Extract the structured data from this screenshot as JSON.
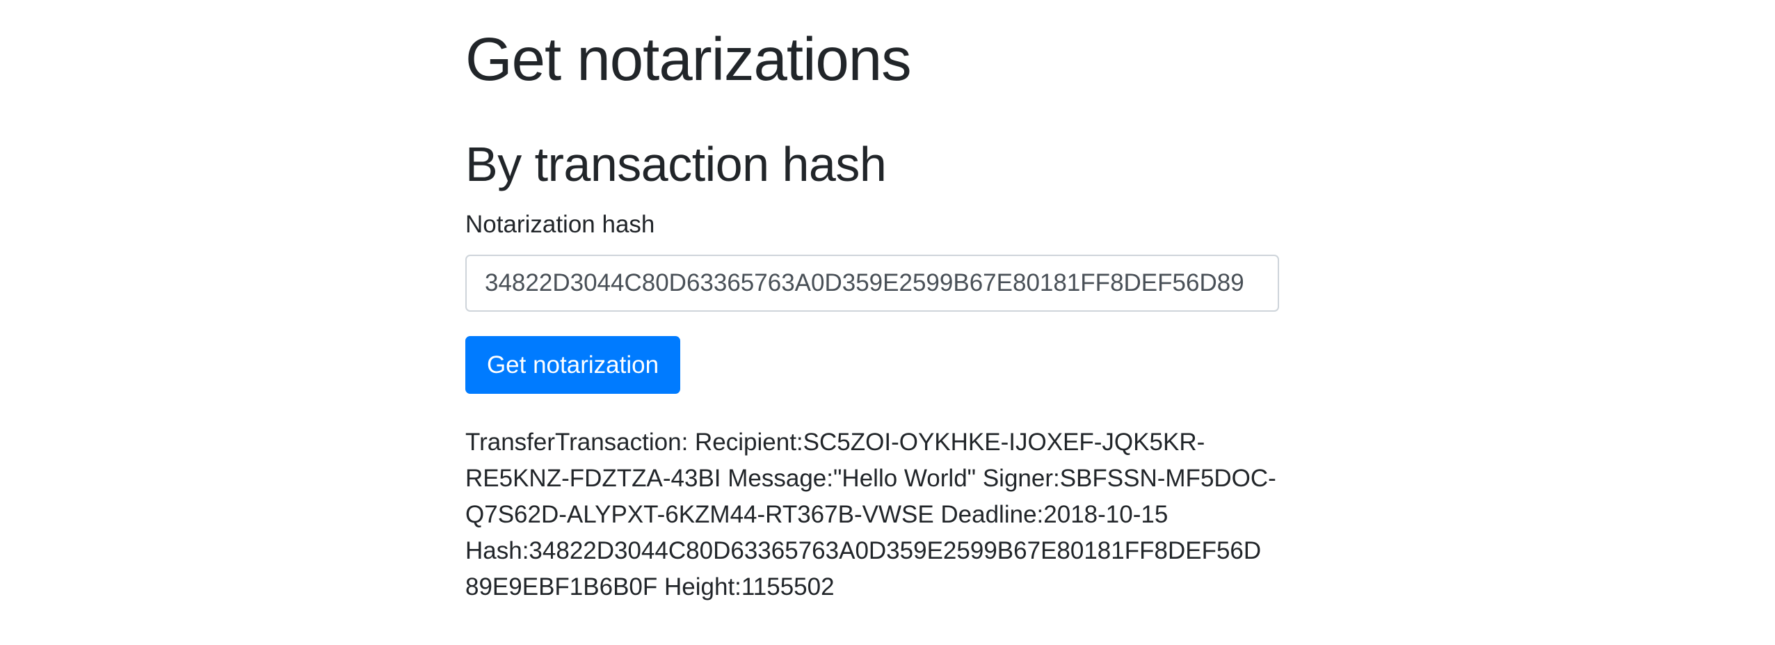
{
  "page": {
    "title": "Get notarizations"
  },
  "section": {
    "title": "By transaction hash"
  },
  "form": {
    "label": "Notarization hash",
    "value": "34822D3044C80D63365763A0D359E2599B67E80181FF8DEF56D89",
    "button_label": "Get notarization"
  },
  "result": {
    "lines": [
      "TransferTransaction: Recipient:SC5ZOI-OYKHKE-IJOXEF-JQK5KR-",
      "RE5KNZ-FDZTZA-43BI Message:\"Hello World\" Signer:SBFSSN-MF5DOC-",
      "Q7S62D-ALYPXT-6KZM44-RT367B-VWSE Deadline:2018-10-15",
      "Hash:34822D3044C80D63365763A0D359E2599B67E80181FF8DEF56D",
      "89E9EBF1B6B0F Height:1155502"
    ]
  }
}
